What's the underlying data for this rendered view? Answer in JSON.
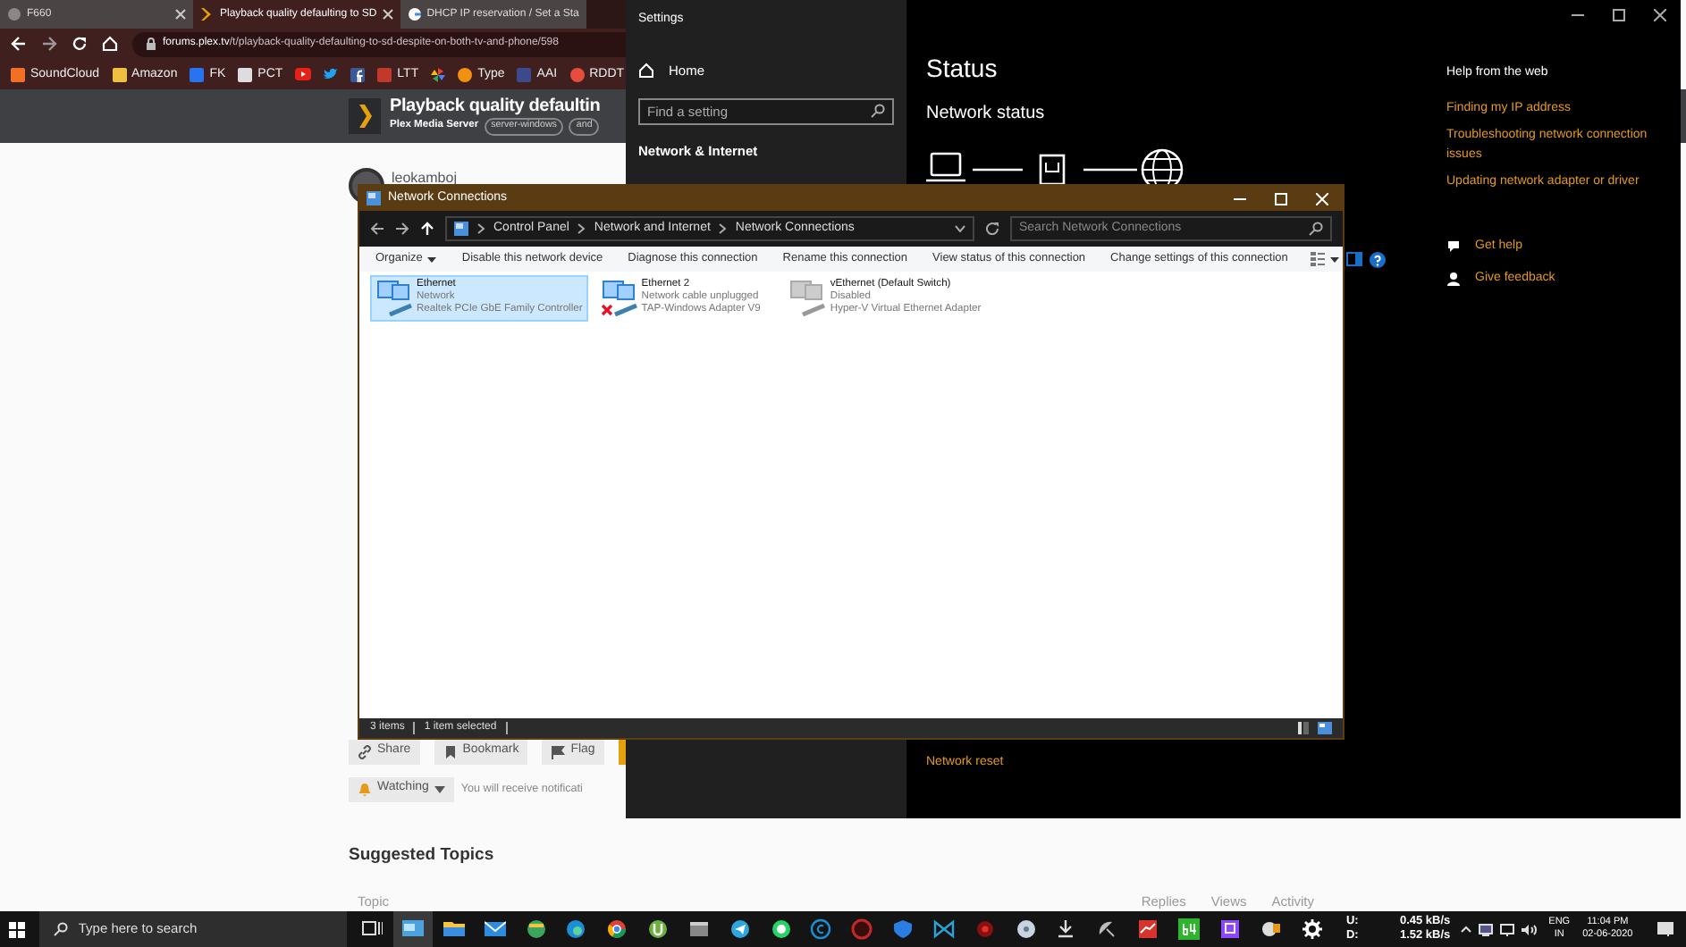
{
  "browser": {
    "tabs": [
      {
        "title": "F660",
        "selected": false
      },
      {
        "title": "Playback quality defaulting to SD",
        "selected": true
      },
      {
        "title": "DHCP IP reservation / Set a Sta",
        "selected": false
      }
    ],
    "url": "**forums.plex.tv**/t/playback-quality-defaulting-to-sd-despite-on-both-tv-and-phone/598",
    "bookmarks": [
      {
        "label": "SoundCloud"
      },
      {
        "label": "Amazon"
      },
      {
        "label": "FK"
      },
      {
        "label": "PCT"
      },
      {
        "label": "LTT"
      },
      {
        "label": "Type"
      },
      {
        "label": "AAI"
      },
      {
        "label": "RDDT"
      }
    ],
    "topic": {
      "title": "Playback quality defaultin",
      "category": "Plex Media Server",
      "tags": [
        "server-windows",
        "and"
      ]
    },
    "post": {
      "username": "leokamboj"
    },
    "actions": [
      "Share",
      "Bookmark",
      "Flag"
    ],
    "watching": {
      "label": "Watching",
      "note": "You will receive notificati"
    },
    "suggested": {
      "heading": "Suggested Topics",
      "columns": [
        "Topic",
        "Replies",
        "Views",
        "Activity"
      ]
    }
  },
  "settings": {
    "title": "Settings",
    "home": "Home",
    "search_placeholder": "Find a setting",
    "section": "Network & Internet",
    "heading": "Status",
    "subheading": "Network status",
    "network_reset": "Network reset",
    "help": {
      "title": "Help from the web",
      "links": [
        "Finding my IP address",
        "Troubleshooting network connection issues",
        "Updating network adapter or driver"
      ]
    },
    "support": [
      "Get help",
      "Give feedback"
    ]
  },
  "connections": {
    "title": "Network Connections",
    "breadcrumb": [
      "Control Panel",
      "Network and Internet",
      "Network Connections"
    ],
    "search_placeholder": "Search Network Connections",
    "toolbar": [
      "Organize",
      "Disable this network device",
      "Diagnose this connection",
      "Rename this connection",
      "View status of this connection",
      "Change settings of this connection"
    ],
    "items": [
      {
        "name": "Ethernet",
        "status": "Network",
        "adapter": "Realtek PCIe GbE Family Controller",
        "selected": true,
        "unplugged": false,
        "disabled": false
      },
      {
        "name": "Ethernet 2",
        "status": "Network cable unplugged",
        "adapter": "TAP-Windows Adapter V9",
        "selected": false,
        "unplugged": true,
        "disabled": false
      },
      {
        "name": "vEthernet (Default Switch)",
        "status": "Disabled",
        "adapter": "Hyper-V Virtual Ethernet Adapter",
        "selected": false,
        "unplugged": false,
        "disabled": true
      }
    ],
    "status_bar": [
      "3 items",
      "1 item selected"
    ]
  },
  "taskbar": {
    "search_placeholder": "Type here to search",
    "upload_label": "U:",
    "download_label": "D:",
    "upload": "0.45 kB/s",
    "download": "1.52 kB/s",
    "language": "ENG",
    "region": "IN",
    "time": "11:04 PM",
    "date": "02-06-2020"
  }
}
